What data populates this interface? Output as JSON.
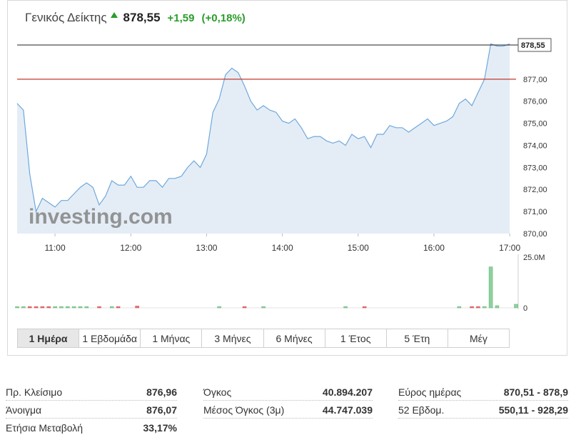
{
  "header": {
    "name": "Γενικός Δείκτης",
    "price": "878,55",
    "change": "+1,59",
    "change_pct": "(+0,18%)",
    "direction_icon": "up-arrow-icon",
    "up_color": "#2a9d2a"
  },
  "watermark": {
    "brand": "investing.com"
  },
  "price_label": "878,55",
  "chart_data": {
    "type": "area",
    "x_ticks": [
      "11:00",
      "12:00",
      "13:00",
      "14:00",
      "15:00",
      "16:00",
      "17:00"
    ],
    "y_ticks": [
      "870,00",
      "871,00",
      "872,00",
      "873,00",
      "874,00",
      "875,00",
      "876,00",
      "877,00"
    ],
    "ylim": [
      870,
      879.1
    ],
    "reference_line": 877.0,
    "current_line": 878.55,
    "line_color": "#6fa8dc",
    "fill_color": "#e4edf6",
    "ref_color": "#c0392b",
    "series": [
      {
        "x": "10:30",
        "y": 875.9
      },
      {
        "x": "10:35",
        "y": 875.6
      },
      {
        "x": "10:40",
        "y": 872.7
      },
      {
        "x": "10:45",
        "y": 871.0
      },
      {
        "x": "10:50",
        "y": 871.6
      },
      {
        "x": "10:55",
        "y": 871.4
      },
      {
        "x": "11:00",
        "y": 871.2
      },
      {
        "x": "11:05",
        "y": 871.5
      },
      {
        "x": "11:10",
        "y": 871.5
      },
      {
        "x": "11:15",
        "y": 871.8
      },
      {
        "x": "11:20",
        "y": 872.1
      },
      {
        "x": "11:25",
        "y": 872.3
      },
      {
        "x": "11:30",
        "y": 872.1
      },
      {
        "x": "11:35",
        "y": 871.3
      },
      {
        "x": "11:40",
        "y": 871.7
      },
      {
        "x": "11:45",
        "y": 872.4
      },
      {
        "x": "11:50",
        "y": 872.2
      },
      {
        "x": "11:55",
        "y": 872.2
      },
      {
        "x": "12:00",
        "y": 872.6
      },
      {
        "x": "12:05",
        "y": 872.1
      },
      {
        "x": "12:10",
        "y": 872.1
      },
      {
        "x": "12:15",
        "y": 872.4
      },
      {
        "x": "12:20",
        "y": 872.4
      },
      {
        "x": "12:25",
        "y": 872.1
      },
      {
        "x": "12:30",
        "y": 872.5
      },
      {
        "x": "12:35",
        "y": 872.5
      },
      {
        "x": "12:40",
        "y": 872.6
      },
      {
        "x": "12:45",
        "y": 873.0
      },
      {
        "x": "12:50",
        "y": 873.3
      },
      {
        "x": "12:55",
        "y": 873.0
      },
      {
        "x": "13:00",
        "y": 873.6
      },
      {
        "x": "13:05",
        "y": 875.5
      },
      {
        "x": "13:10",
        "y": 876.1
      },
      {
        "x": "13:15",
        "y": 877.2
      },
      {
        "x": "13:20",
        "y": 877.5
      },
      {
        "x": "13:25",
        "y": 877.3
      },
      {
        "x": "13:30",
        "y": 876.7
      },
      {
        "x": "13:35",
        "y": 876.0
      },
      {
        "x": "13:40",
        "y": 875.6
      },
      {
        "x": "13:45",
        "y": 875.8
      },
      {
        "x": "13:50",
        "y": 875.6
      },
      {
        "x": "13:55",
        "y": 875.5
      },
      {
        "x": "14:00",
        "y": 875.1
      },
      {
        "x": "14:05",
        "y": 875.0
      },
      {
        "x": "14:10",
        "y": 875.2
      },
      {
        "x": "14:15",
        "y": 874.8
      },
      {
        "x": "14:20",
        "y": 874.3
      },
      {
        "x": "14:25",
        "y": 874.4
      },
      {
        "x": "14:30",
        "y": 874.4
      },
      {
        "x": "14:35",
        "y": 874.2
      },
      {
        "x": "14:40",
        "y": 874.1
      },
      {
        "x": "14:45",
        "y": 874.2
      },
      {
        "x": "14:50",
        "y": 874.0
      },
      {
        "x": "14:55",
        "y": 874.5
      },
      {
        "x": "15:00",
        "y": 874.3
      },
      {
        "x": "15:05",
        "y": 874.4
      },
      {
        "x": "15:10",
        "y": 873.9
      },
      {
        "x": "15:15",
        "y": 874.5
      },
      {
        "x": "15:20",
        "y": 874.5
      },
      {
        "x": "15:25",
        "y": 874.9
      },
      {
        "x": "15:30",
        "y": 874.8
      },
      {
        "x": "15:35",
        "y": 874.8
      },
      {
        "x": "15:40",
        "y": 874.6
      },
      {
        "x": "15:45",
        "y": 874.8
      },
      {
        "x": "15:50",
        "y": 875.0
      },
      {
        "x": "15:55",
        "y": 875.2
      },
      {
        "x": "16:00",
        "y": 874.9
      },
      {
        "x": "16:05",
        "y": 875.0
      },
      {
        "x": "16:10",
        "y": 875.1
      },
      {
        "x": "16:15",
        "y": 875.3
      },
      {
        "x": "16:20",
        "y": 875.9
      },
      {
        "x": "16:25",
        "y": 876.1
      },
      {
        "x": "16:30",
        "y": 875.8
      },
      {
        "x": "16:35",
        "y": 876.4
      },
      {
        "x": "16:40",
        "y": 877.0
      },
      {
        "x": "16:45",
        "y": 878.6
      },
      {
        "x": "16:50",
        "y": 878.5
      },
      {
        "x": "16:55",
        "y": 878.5
      },
      {
        "x": "17:00",
        "y": 878.6
      }
    ],
    "volume": {
      "ylim": [
        0,
        25000000
      ],
      "ticks": [
        "25.0M",
        "0"
      ],
      "up_color": "#8fd19e",
      "down_color": "#e57373",
      "bars": [
        {
          "x": "10:30",
          "v": 250000,
          "dir": "up"
        },
        {
          "x": "10:35",
          "v": 250000,
          "dir": "up"
        },
        {
          "x": "10:40",
          "v": 300000,
          "dir": "down"
        },
        {
          "x": "10:45",
          "v": 400000,
          "dir": "down"
        },
        {
          "x": "10:50",
          "v": 350000,
          "dir": "down"
        },
        {
          "x": "10:55",
          "v": 300000,
          "dir": "down"
        },
        {
          "x": "11:00",
          "v": 250000,
          "dir": "up"
        },
        {
          "x": "11:05",
          "v": 250000,
          "dir": "up"
        },
        {
          "x": "11:10",
          "v": 250000,
          "dir": "up"
        },
        {
          "x": "11:15",
          "v": 250000,
          "dir": "up"
        },
        {
          "x": "11:20",
          "v": 250000,
          "dir": "up"
        },
        {
          "x": "11:25",
          "v": 250000,
          "dir": "up"
        },
        {
          "x": "11:35",
          "v": 400000,
          "dir": "down"
        },
        {
          "x": "11:45",
          "v": 250000,
          "dir": "up"
        },
        {
          "x": "11:50",
          "v": 300000,
          "dir": "down"
        },
        {
          "x": "12:05",
          "v": 900000,
          "dir": "down"
        },
        {
          "x": "13:10",
          "v": 250000,
          "dir": "up"
        },
        {
          "x": "13:30",
          "v": 300000,
          "dir": "down"
        },
        {
          "x": "13:45",
          "v": 250000,
          "dir": "up"
        },
        {
          "x": "14:50",
          "v": 250000,
          "dir": "up"
        },
        {
          "x": "15:05",
          "v": 300000,
          "dir": "down"
        },
        {
          "x": "16:20",
          "v": 250000,
          "dir": "up"
        },
        {
          "x": "16:30",
          "v": 300000,
          "dir": "down"
        },
        {
          "x": "16:35",
          "v": 300000,
          "dir": "down"
        },
        {
          "x": "16:40",
          "v": 400000,
          "dir": "up"
        },
        {
          "x": "16:45",
          "v": 20500000,
          "dir": "up"
        },
        {
          "x": "16:50",
          "v": 1100000,
          "dir": "up"
        },
        {
          "x": "17:05",
          "v": 1800000,
          "dir": "up"
        }
      ]
    }
  },
  "tabs": [
    {
      "label": "1 Ημέρα",
      "active": true
    },
    {
      "label": "1 Εβδομάδα"
    },
    {
      "label": "1 Μήνας"
    },
    {
      "label": "3 Μήνες"
    },
    {
      "label": "6 Μήνες"
    },
    {
      "label": "1 Έτος"
    },
    {
      "label": "5 Έτη"
    },
    {
      "label": "Μέγ"
    }
  ],
  "stats": {
    "prev_close": {
      "label": "Πρ. Κλείσιμο",
      "value": "876,96"
    },
    "open": {
      "label": "Άνοιγμα",
      "value": "876,07"
    },
    "annual_change": {
      "label": "Ετήσια Μεταβολή",
      "value": "33,17%"
    },
    "volume": {
      "label": "Όγκος",
      "value": "40.894.207"
    },
    "avg_volume": {
      "label": "Μέσος Όγκος (3μ)",
      "value": "44.747.039"
    },
    "day_range": {
      "label": "Εύρος ημέρας",
      "value": "870,51 - 878,9"
    },
    "week52": {
      "label": "52 Εβδομ.",
      "value": "550,11 - 928,29"
    }
  }
}
